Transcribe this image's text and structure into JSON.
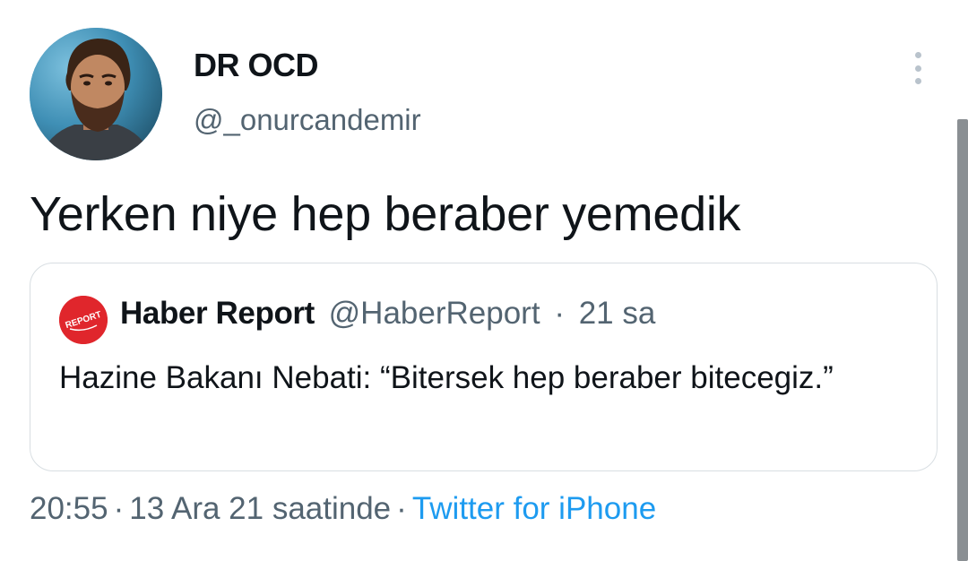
{
  "author": {
    "display_name": "DR OCD",
    "handle": "@_onurcandemir"
  },
  "tweet": {
    "text": "Yerken niye hep beraber yemedik"
  },
  "quoted_tweet": {
    "logo_text": "REPORT",
    "display_name": "Haber Report",
    "handle": "@HaberReport",
    "separator": "·",
    "time_ago": "21 sa",
    "text": "Hazine Bakanı Nebati: “Bitersek hep beraber bitecegiz.”"
  },
  "meta": {
    "time": "20:55",
    "separator": "·",
    "date": "13 Ara 21 saatinde",
    "source": "Twitter for iPhone"
  },
  "colors": {
    "primary_text": "#0f1419",
    "secondary_text": "#536471",
    "link": "#1d9bf0",
    "logo_red": "#e0262c",
    "border": "#d8dee2"
  },
  "icons": {
    "more": "more-vertical-icon"
  }
}
